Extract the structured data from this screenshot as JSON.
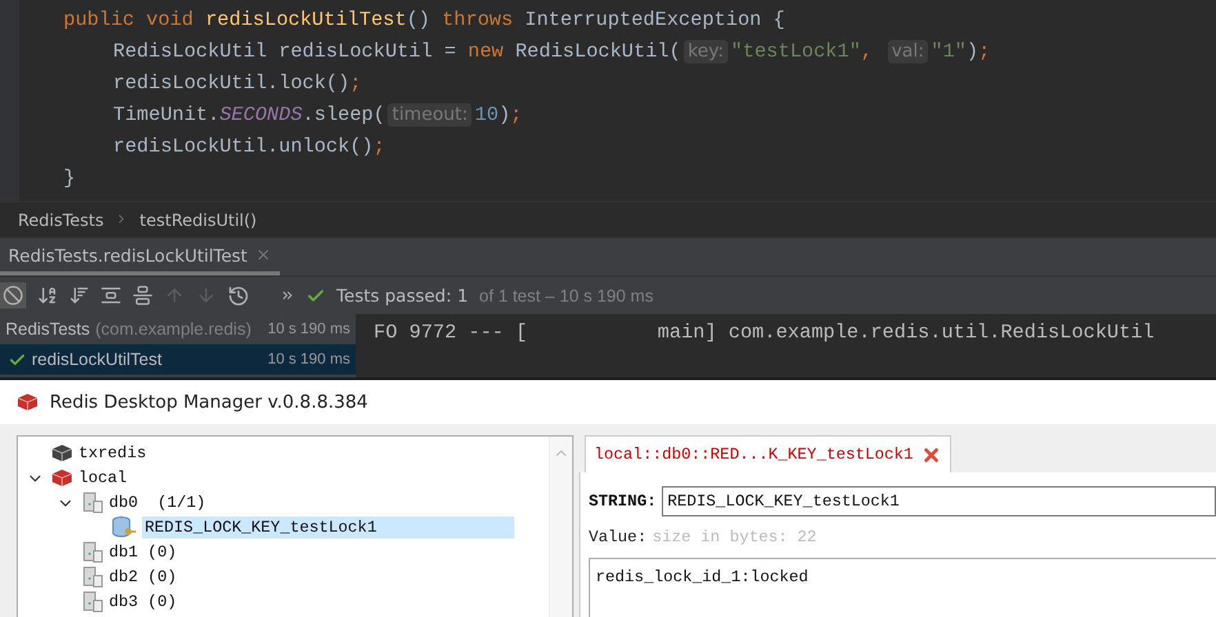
{
  "editor": {
    "lines": [
      {
        "tokens": [
          {
            "kind": "keyword",
            "text": "public void "
          },
          {
            "kind": "method",
            "text": "redisLockUtilTest"
          },
          {
            "kind": "plain",
            "text": "() "
          },
          {
            "kind": "keyword",
            "text": "throws "
          },
          {
            "kind": "plain",
            "text": "InterruptedException {"
          }
        ],
        "children": [
          {
            "tokens": [
              {
                "kind": "plain",
                "text": "RedisLockUtil redisLockUtil = "
              },
              {
                "kind": "keyword",
                "text": "new "
              },
              {
                "kind": "plain",
                "text": "RedisLockUtil("
              },
              {
                "kind": "hint",
                "text": "key:"
              },
              {
                "kind": "string",
                "text": "\"testLock1\""
              },
              {
                "kind": "keyword",
                "text": ", "
              },
              {
                "kind": "hint",
                "text": "val:"
              },
              {
                "kind": "string",
                "text": "\"1\""
              },
              {
                "kind": "plain",
                "text": ")"
              },
              {
                "kind": "keyword",
                "text": ";"
              }
            ]
          },
          {
            "tokens": [
              {
                "kind": "plain",
                "text": "redisLockUtil.lock()"
              },
              {
                "kind": "keyword",
                "text": ";"
              }
            ]
          },
          {
            "tokens": [
              {
                "kind": "plain",
                "text": "TimeUnit."
              },
              {
                "kind": "static",
                "text": "SECONDS"
              },
              {
                "kind": "plain",
                "text": ".sleep("
              },
              {
                "kind": "hint",
                "text": "timeout:"
              },
              {
                "kind": "number",
                "text": "10"
              },
              {
                "kind": "plain",
                "text": ")"
              },
              {
                "kind": "keyword",
                "text": ";"
              }
            ]
          },
          {
            "tokens": [
              {
                "kind": "plain",
                "text": "redisLockUtil.unlock()"
              },
              {
                "kind": "keyword",
                "text": ";"
              }
            ]
          }
        ]
      },
      {
        "tokens": [
          {
            "kind": "plain",
            "text": "}"
          }
        ]
      }
    ]
  },
  "breadcrumb": [
    "RedisTests",
    "testRedisUtil()"
  ],
  "run_tabs": [
    {
      "label": "RedisTests.redisLockUtilTest",
      "selected": true
    }
  ],
  "toolbar": {
    "status": "Tests passed:",
    "count": "1",
    "detail": "of 1 test – 10 s 190 ms"
  },
  "test_tree": [
    {
      "name": "RedisTests",
      "package": "(com.example.redis)",
      "time": "10 s 190 ms",
      "passed": false,
      "selected": false
    },
    {
      "name": "redisLockUtilTest",
      "time": "10 s 190 ms",
      "passed": true,
      "selected": true
    }
  ],
  "console": {
    "line": "FO 9772 --- [           main] com.example.redis.util.RedisLockUtil"
  },
  "rdm": {
    "title": "Redis Desktop Manager v.0.8.8.384",
    "tree": [
      {
        "kind": "server",
        "label": "txredis",
        "connected": false,
        "expanded": false,
        "selected": false
      },
      {
        "kind": "server",
        "label": "local",
        "connected": true,
        "expanded": true,
        "selected": false,
        "children": [
          {
            "kind": "db",
            "label": "db0  (1/1)",
            "expanded": true,
            "selected": false,
            "children": [
              {
                "kind": "key",
                "label": "REDIS_LOCK_KEY_testLock1",
                "selected": true
              }
            ]
          },
          {
            "kind": "db",
            "label": "db1 (0)",
            "expanded": false,
            "selected": false
          },
          {
            "kind": "db",
            "label": "db2 (0)",
            "expanded": false,
            "selected": false
          },
          {
            "kind": "db",
            "label": "db3 (0)",
            "expanded": false,
            "selected": false
          }
        ]
      }
    ],
    "tab": {
      "label": "local::db0::RED...K_KEY_testLock1"
    },
    "key_type": "STRING:",
    "key_name": "REDIS_LOCK_KEY_testLock1",
    "value_label": "Value:",
    "value_size": "size in bytes: 22",
    "value": "redis_lock_id_1:locked"
  }
}
